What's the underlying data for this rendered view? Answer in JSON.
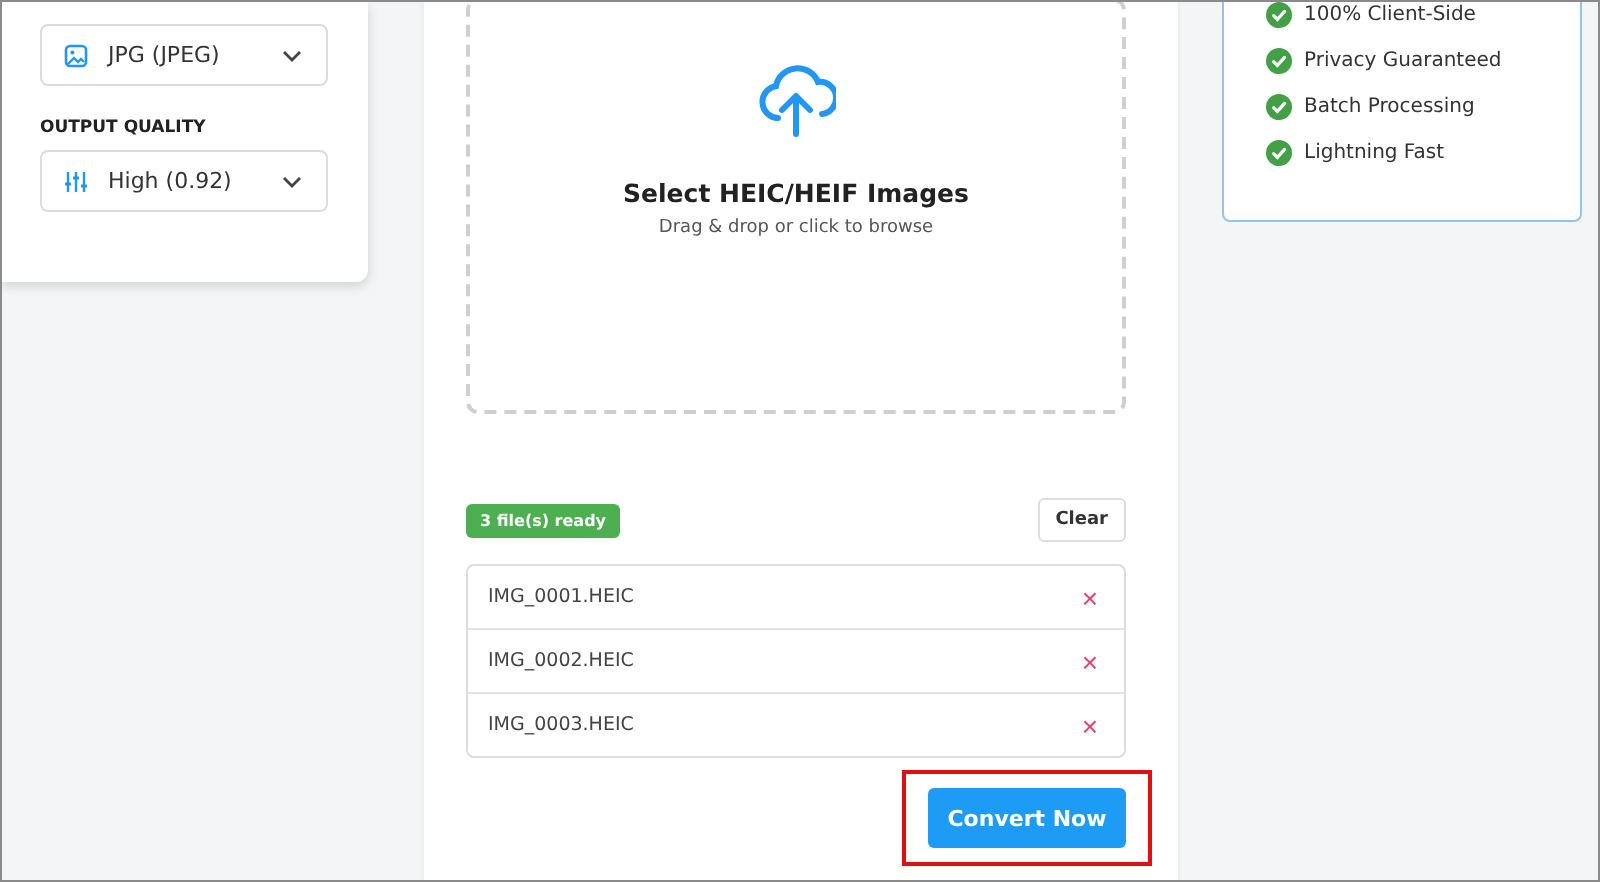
{
  "settings": {
    "format_select": {
      "value": "JPG (JPEG)"
    },
    "quality_label": "OUTPUT QUALITY",
    "quality_select": {
      "value": "High (0.92)"
    }
  },
  "upload": {
    "title": "Select HEIC/HEIF Images",
    "subtitle": "Drag & drop or click to browse"
  },
  "files": {
    "badge": "3 file(s) ready",
    "clear_button": "Clear",
    "items": [
      {
        "name": "IMG_0001.HEIC",
        "remove": "×"
      },
      {
        "name": "IMG_0002.HEIC",
        "remove": "×"
      },
      {
        "name": "IMG_0003.HEIC",
        "remove": "×"
      }
    ],
    "convert_button": "Convert Now",
    "convert_highlighted": true
  },
  "features": [
    "100% Client-Side",
    "Privacy Guaranteed",
    "Batch Processing",
    "Lightning Fast"
  ]
}
